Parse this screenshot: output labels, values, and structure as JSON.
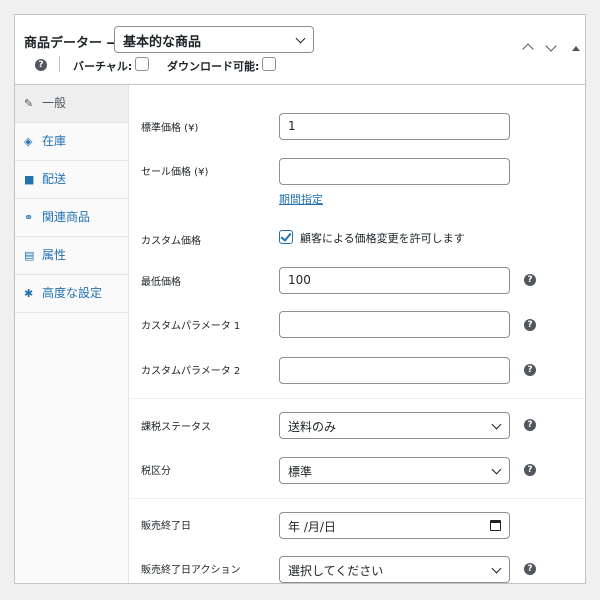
{
  "header": {
    "title": "商品データー —",
    "product_type": "基本的な商品",
    "virtual_label": "バーチャル:",
    "downloadable_label": "ダウンロード可能:",
    "help_glyph": "?"
  },
  "sidebar": {
    "items": [
      {
        "label": "一般",
        "icon": "wrench-icon",
        "glyph": "✎",
        "active": true
      },
      {
        "label": "在庫",
        "icon": "tag-icon",
        "glyph": "◈",
        "active": false
      },
      {
        "label": "配送",
        "icon": "truck-icon",
        "glyph": "■",
        "active": false
      },
      {
        "label": "関連商品",
        "icon": "link-icon",
        "glyph": "⚭",
        "active": false
      },
      {
        "label": "属性",
        "icon": "list-icon",
        "glyph": "▤",
        "active": false
      },
      {
        "label": "高度な設定",
        "icon": "gear-icon",
        "glyph": "✱",
        "active": false
      }
    ]
  },
  "fields": {
    "regular_price": {
      "label": "標準価格 (¥)",
      "value": "1"
    },
    "sale_price": {
      "label": "セール価格 (¥)",
      "value": "",
      "schedule_link": "期間指定"
    },
    "custom_price": {
      "label": "カスタム価格",
      "checkbox_text": "顧客による価格変更を許可します",
      "checked": true
    },
    "min_price": {
      "label": "最低価格",
      "value": "100"
    },
    "custom_param_1": {
      "label": "カスタムパラメータ 1",
      "value": ""
    },
    "custom_param_2": {
      "label": "カスタムパラメータ 2",
      "value": ""
    },
    "tax_status": {
      "label": "課税ステータス",
      "value": "送料のみ"
    },
    "tax_class": {
      "label": "税区分",
      "value": "標準"
    },
    "sale_end_date": {
      "label": "販売終了日",
      "value": "年 /月/日"
    },
    "sale_end_action": {
      "label": "販売終了日アクション",
      "value": "選択してください"
    }
  },
  "colors": {
    "accent": "#2271b1",
    "border": "#8c8f94"
  }
}
